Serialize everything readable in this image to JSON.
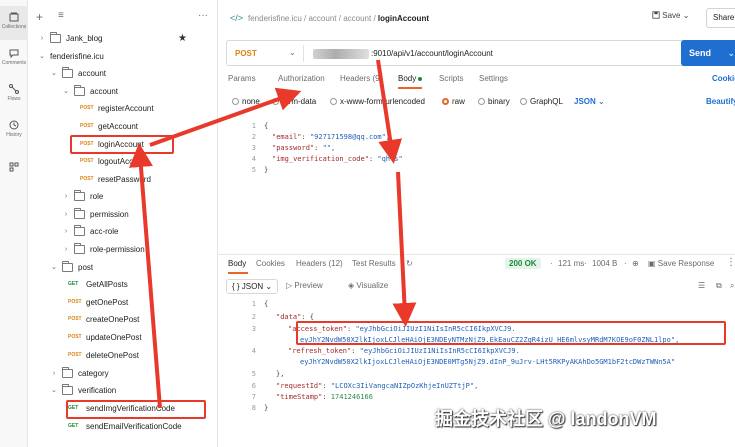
{
  "rail": {
    "items": [
      {
        "label": "Collections"
      },
      {
        "label": "Comments"
      },
      {
        "label": "Flows"
      },
      {
        "label": "History"
      }
    ]
  },
  "sidebar": {
    "items": [
      {
        "kind": "folder",
        "label": "Jank_blog",
        "level": 0,
        "chev": "›"
      },
      {
        "kind": "folder",
        "label": "fenderisfine.icu",
        "level": 0,
        "chev": "⌄",
        "nofolder": true
      },
      {
        "kind": "folder",
        "label": "account",
        "level": 1,
        "chev": "⌄"
      },
      {
        "kind": "folder",
        "label": "account",
        "level": 2,
        "chev": "⌄"
      },
      {
        "kind": "req",
        "method": "POST",
        "label": "registerAccount",
        "level": 3
      },
      {
        "kind": "req",
        "method": "POST",
        "label": "getAccount",
        "level": 3
      },
      {
        "kind": "req",
        "method": "POST",
        "label": "loginAccount",
        "level": 3
      },
      {
        "kind": "req",
        "method": "POST",
        "label": "logoutAccount",
        "level": 3
      },
      {
        "kind": "req",
        "method": "POST",
        "label": "resetPassword",
        "level": 3
      },
      {
        "kind": "folder",
        "label": "role",
        "level": 2,
        "chev": "›"
      },
      {
        "kind": "folder",
        "label": "permission",
        "level": 2,
        "chev": "›"
      },
      {
        "kind": "folder",
        "label": "acc-role",
        "level": 2,
        "chev": "›"
      },
      {
        "kind": "folder",
        "label": "role-permission",
        "level": 2,
        "chev": "›"
      },
      {
        "kind": "folder",
        "label": "post",
        "level": 1,
        "chev": "⌄"
      },
      {
        "kind": "req",
        "method": "GET",
        "label": "GetAllPosts",
        "level": 2
      },
      {
        "kind": "req",
        "method": "POST",
        "label": "getOnePost",
        "level": 2
      },
      {
        "kind": "req",
        "method": "POST",
        "label": "createOnePost",
        "level": 2
      },
      {
        "kind": "req",
        "method": "POST",
        "label": "updateOnePost",
        "level": 2
      },
      {
        "kind": "req",
        "method": "POST",
        "label": "deleteOnePost",
        "level": 2
      },
      {
        "kind": "folder",
        "label": "category",
        "level": 1,
        "chev": "›"
      },
      {
        "kind": "folder",
        "label": "verification",
        "level": 1,
        "chev": "⌄"
      },
      {
        "kind": "req",
        "method": "GET",
        "label": "sendImgVerificationCode",
        "level": 2
      },
      {
        "kind": "req",
        "method": "GET",
        "label": "sendEmailVerificationCode",
        "level": 2
      }
    ]
  },
  "header": {
    "crumb_1": "fenderisfine.icu",
    "crumb_2": "account",
    "crumb_3": "account",
    "crumb_current": "loginAccount",
    "save_label": "Save",
    "share_label": "Share"
  },
  "request": {
    "method": "POST",
    "url": ":9010/api/v1/account/loginAccount",
    "send_label": "Send"
  },
  "req_tabs": {
    "params": "Params",
    "authorization": "Authorization",
    "headers": "Headers (9)",
    "body": "Body",
    "scripts": "Scripts",
    "settings": "Settings",
    "cookies": "Cookies"
  },
  "body_modes": {
    "none": "none",
    "form_data": "form-data",
    "urlencoded": "x-www-form-urlencoded",
    "raw": "raw",
    "binary": "binary",
    "graphql": "GraphQL",
    "json": "JSON",
    "beautify": "Beautify"
  },
  "request_body": {
    "lines": [
      {
        "n": "1",
        "text": "{"
      },
      {
        "n": "2",
        "key": "\"email\"",
        "val": "\"927171598@qq.com\","
      },
      {
        "n": "3",
        "key": "\"password\"",
        "val": "\"\","
      },
      {
        "n": "4",
        "key": "\"img_verification_code\"",
        "val": "\"qhfs\""
      },
      {
        "n": "5",
        "text": "}"
      }
    ]
  },
  "response_tabs": {
    "body": "Body",
    "cookies": "Cookies",
    "headers": "Headers (12)",
    "test_results": "Test Results",
    "status": "200 OK",
    "time": "121 ms",
    "size": "1004 B",
    "save_response": "Save Response"
  },
  "response_bar": {
    "format": "JSON",
    "preview": "Preview",
    "visualize": "Visualize"
  },
  "response_body": {
    "lines": [
      {
        "n": "1",
        "text": "{"
      },
      {
        "n": "2",
        "key": "\"data\"",
        "val": "{"
      },
      {
        "n": "3",
        "key": "\"access_token\"",
        "val": "\"eyJhbGciOiJIUzI1NiIsInR5cCI6IkpXVCJ9."
      },
      {
        "n": "",
        "text": "eyJhY2NvdW50X2lkIjoxLCJleHAiOjE3NDEyNTMzNjZ9.EkEauCZ2ZgR4izU_HE6mlvsyMRdM7KOE9oF0ZNL1lpo\","
      },
      {
        "n": "4",
        "key": "\"refresh_token\"",
        "val": "\"eyJhbGciOiJIUzI1NiIsInR5cCI6IkpXVCJ9."
      },
      {
        "n": "",
        "text": "eyJhY2NvdW50X2lkIjoxLCJleHAiOjE3NDE0MTg5NjZ9.dInP_9uJrv-LHt5RKPyAKAhDo5GM1bF2tcDWzTWNn5A\""
      },
      {
        "n": "5",
        "text": "},"
      },
      {
        "n": "6",
        "key": "\"requestId\"",
        "val": "\"LCOXc3IiVangcaNIZpOzKhjeInUZTtjP\","
      },
      {
        "n": "7",
        "key": "\"timeStamp\"",
        "val": "1741246166"
      },
      {
        "n": "8",
        "text": "}"
      }
    ]
  },
  "watermark": "掘金技术社区 @ landonVM",
  "colors": {
    "accent": "#e8662a",
    "send": "#1f6fd1",
    "post": "#d98511",
    "get": "#1d8a3a",
    "annotation": "#e8392a"
  }
}
